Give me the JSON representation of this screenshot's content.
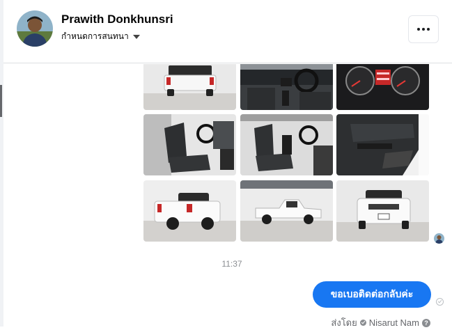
{
  "header": {
    "name": "Prawith Donkhunsri",
    "subtitle": "กำหนดการสนทนา",
    "more_icon": "more-horizontal-icon"
  },
  "photos": [
    {
      "id": "truck-rear-studio",
      "subject": "pickup-truck-rear"
    },
    {
      "id": "dashboard",
      "subject": "interior-dashboard"
    },
    {
      "id": "gauges",
      "subject": "instrument-cluster"
    },
    {
      "id": "driver-seat",
      "subject": "front-seats"
    },
    {
      "id": "cab-interior",
      "subject": "cab-interior-wide"
    },
    {
      "id": "door-panel",
      "subject": "door-panel"
    },
    {
      "id": "truck-rear-three-quarter",
      "subject": "pickup-truck-rear-quarter"
    },
    {
      "id": "truck-side",
      "subject": "pickup-truck-side"
    },
    {
      "id": "truck-front",
      "subject": "pickup-truck-front"
    }
  ],
  "timestamp": "11:37",
  "message": {
    "text": "ขอเบอติดต่อกลับค่ะ",
    "sent_by_label": "ส่งโดย",
    "sender": "Nisarut Nam",
    "help": "?"
  },
  "colors": {
    "bubble": "#1877f2",
    "muted": "#65676b",
    "divider": "#dddfe2"
  }
}
